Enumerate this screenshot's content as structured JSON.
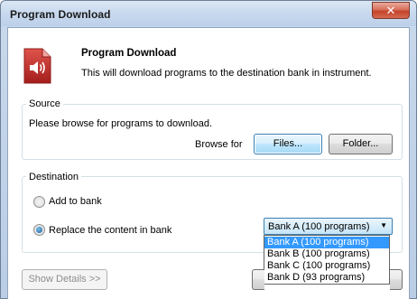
{
  "window": {
    "title": "Program Download",
    "close_glyph": "✕"
  },
  "header": {
    "icon": "speaker-download-icon",
    "title": "Program Download",
    "description": "This will download programs to the destination bank in instrument."
  },
  "source": {
    "legend": "Source",
    "prompt": "Please browse for programs to download.",
    "browse_label": "Browse for",
    "files_button": "Files...",
    "folder_button": "Folder..."
  },
  "destination": {
    "legend": "Destination",
    "add_option": "Add to bank",
    "replace_option": "Replace the content in bank",
    "selected_option": "replace",
    "bank_selected": "Bank A (100 programs)",
    "bank_options": [
      "Bank A (100 programs)",
      "Bank B (100 programs)",
      "Bank C (100 programs)",
      "Bank D (93 programs)"
    ]
  },
  "footer": {
    "show_details_button": "Show Details >>"
  },
  "colors": {
    "accent": "#3399ff",
    "icon_red": "#c8302d",
    "titlebar": "#c8d9ee"
  }
}
